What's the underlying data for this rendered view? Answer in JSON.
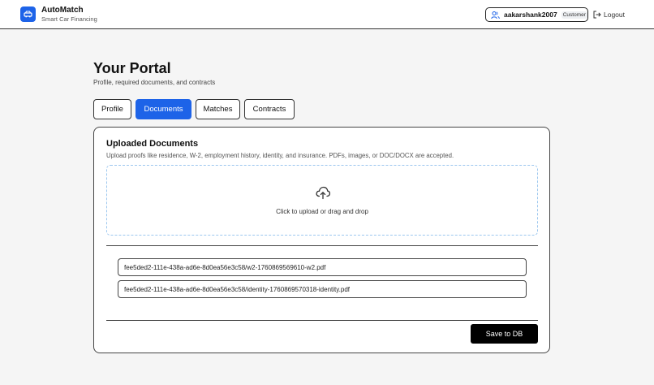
{
  "header": {
    "app_name": "AutoMatch",
    "tagline": "Smart Car Financing",
    "username": "aakarshank2007",
    "role": "Customer",
    "logout_label": "Logout"
  },
  "page": {
    "title": "Your Portal",
    "subtitle": "Profile, required documents, and contracts"
  },
  "tabs": [
    {
      "label": "Profile",
      "active": false
    },
    {
      "label": "Documents",
      "active": true
    },
    {
      "label": "Matches",
      "active": false
    },
    {
      "label": "Contracts",
      "active": false
    }
  ],
  "documents": {
    "title": "Uploaded Documents",
    "description": "Upload proofs like residence, W-2, employment history, identity, and insurance. PDFs, images, or DOC/DOCX are accepted.",
    "dropzone_text": "Click to upload or drag and drop",
    "files": [
      "fee5ded2-111e-438a-ad6e-8d0ea56e3c58/w2-1760869569610-w2.pdf",
      "fee5ded2-111e-438a-ad6e-8d0ea56e3c58/identity-1760869570318-identity.pdf"
    ],
    "save_label": "Save to DB"
  },
  "icons": {
    "brand": "car-icon",
    "user": "user-icon",
    "logout": "logout-icon",
    "upload": "cloud-upload-icon"
  },
  "colors": {
    "accent": "#1d63e8",
    "dropzone_border": "#9cc7ef",
    "save_button": "#000000"
  }
}
